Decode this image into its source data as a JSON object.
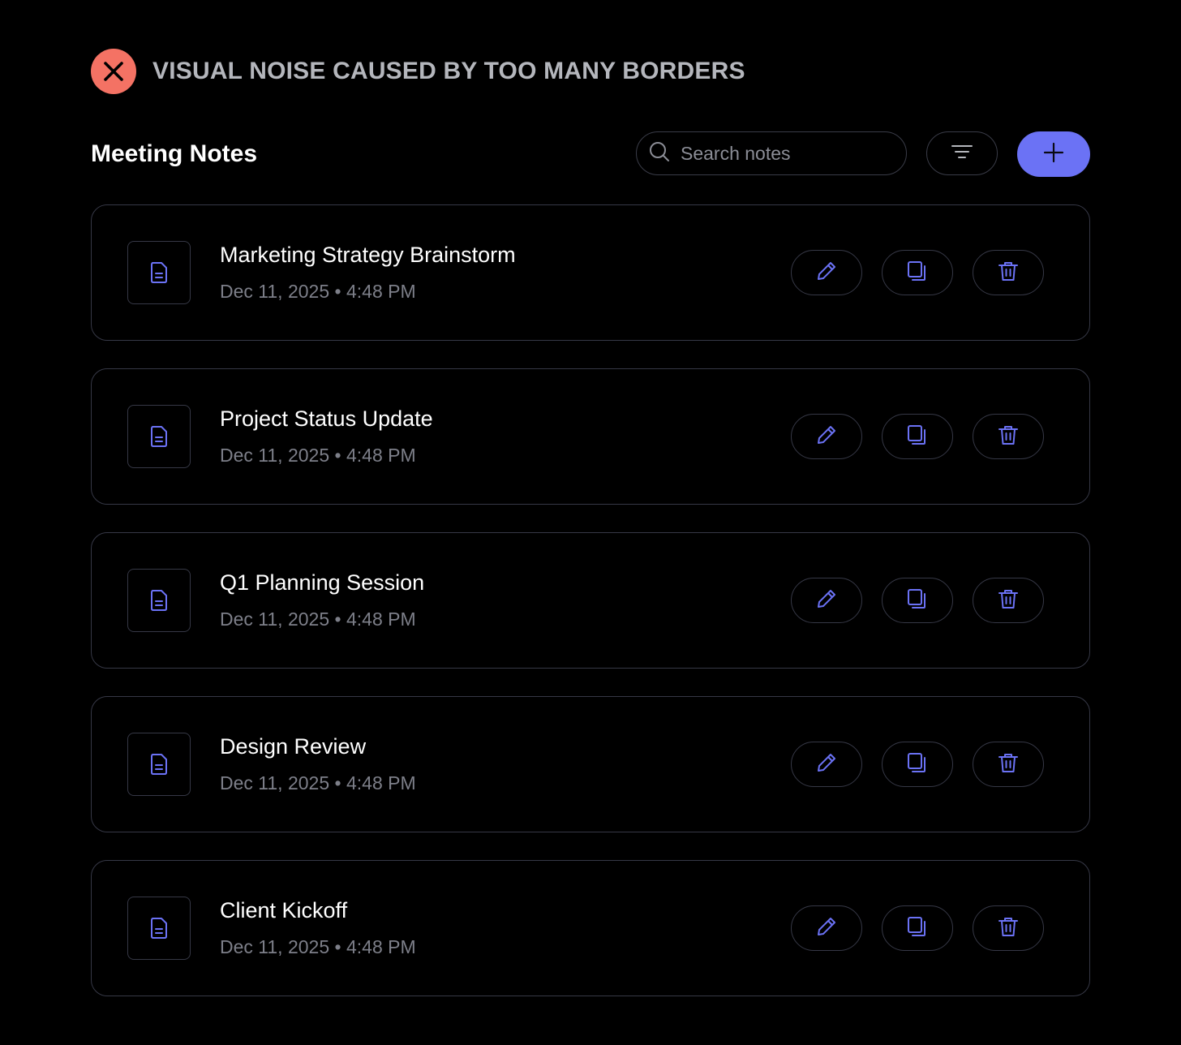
{
  "banner": {
    "title": "VISUAL NOISE CAUSED BY TOO MANY BORDERS",
    "icon": "close-icon",
    "badge_color": "#f47264"
  },
  "header": {
    "title": "Meeting Notes",
    "search": {
      "placeholder": "Search notes",
      "value": ""
    },
    "filter_icon": "filter-icon",
    "add_icon": "plus-icon",
    "accent_color": "#6b72f5"
  },
  "notes": [
    {
      "title": "Marketing Strategy Brainstorm",
      "date": "Dec 11, 2025",
      "time": "4:48 PM"
    },
    {
      "title": "Project Status Update",
      "date": "Dec 11, 2025",
      "time": "4:48 PM"
    },
    {
      "title": "Q1 Planning Session",
      "date": "Dec 11, 2025",
      "time": "4:48 PM"
    },
    {
      "title": "Design Review",
      "date": "Dec 11, 2025",
      "time": "4:48 PM"
    },
    {
      "title": "Client Kickoff",
      "date": "Dec 11, 2025",
      "time": "4:48 PM"
    }
  ],
  "actions": {
    "edit_icon": "pencil-icon",
    "copy_icon": "copy-icon",
    "delete_icon": "trash-icon"
  }
}
